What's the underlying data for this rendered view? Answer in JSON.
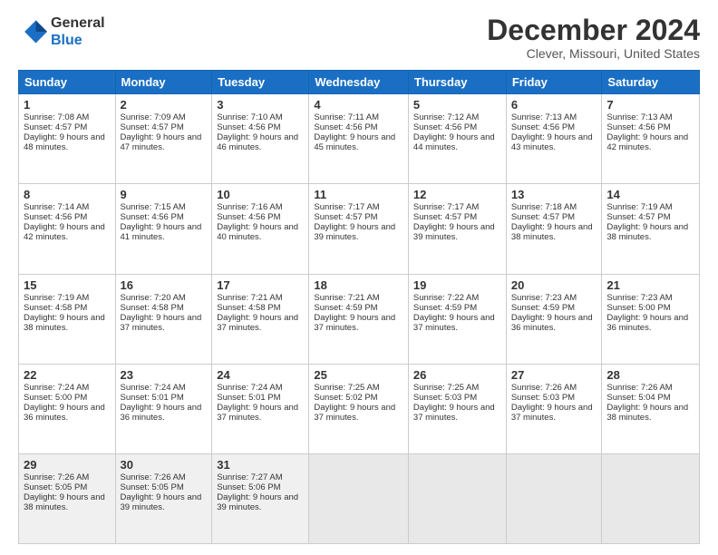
{
  "logo": {
    "line1": "General",
    "line2": "Blue"
  },
  "header": {
    "month": "December 2024",
    "location": "Clever, Missouri, United States"
  },
  "weekdays": [
    "Sunday",
    "Monday",
    "Tuesday",
    "Wednesday",
    "Thursday",
    "Friday",
    "Saturday"
  ],
  "weeks": [
    [
      {
        "day": "1",
        "sunrise": "Sunrise: 7:08 AM",
        "sunset": "Sunset: 4:57 PM",
        "daylight": "Daylight: 9 hours and 48 minutes."
      },
      {
        "day": "2",
        "sunrise": "Sunrise: 7:09 AM",
        "sunset": "Sunset: 4:57 PM",
        "daylight": "Daylight: 9 hours and 47 minutes."
      },
      {
        "day": "3",
        "sunrise": "Sunrise: 7:10 AM",
        "sunset": "Sunset: 4:56 PM",
        "daylight": "Daylight: 9 hours and 46 minutes."
      },
      {
        "day": "4",
        "sunrise": "Sunrise: 7:11 AM",
        "sunset": "Sunset: 4:56 PM",
        "daylight": "Daylight: 9 hours and 45 minutes."
      },
      {
        "day": "5",
        "sunrise": "Sunrise: 7:12 AM",
        "sunset": "Sunset: 4:56 PM",
        "daylight": "Daylight: 9 hours and 44 minutes."
      },
      {
        "day": "6",
        "sunrise": "Sunrise: 7:13 AM",
        "sunset": "Sunset: 4:56 PM",
        "daylight": "Daylight: 9 hours and 43 minutes."
      },
      {
        "day": "7",
        "sunrise": "Sunrise: 7:13 AM",
        "sunset": "Sunset: 4:56 PM",
        "daylight": "Daylight: 9 hours and 42 minutes."
      }
    ],
    [
      {
        "day": "8",
        "sunrise": "Sunrise: 7:14 AM",
        "sunset": "Sunset: 4:56 PM",
        "daylight": "Daylight: 9 hours and 42 minutes."
      },
      {
        "day": "9",
        "sunrise": "Sunrise: 7:15 AM",
        "sunset": "Sunset: 4:56 PM",
        "daylight": "Daylight: 9 hours and 41 minutes."
      },
      {
        "day": "10",
        "sunrise": "Sunrise: 7:16 AM",
        "sunset": "Sunset: 4:56 PM",
        "daylight": "Daylight: 9 hours and 40 minutes."
      },
      {
        "day": "11",
        "sunrise": "Sunrise: 7:17 AM",
        "sunset": "Sunset: 4:57 PM",
        "daylight": "Daylight: 9 hours and 39 minutes."
      },
      {
        "day": "12",
        "sunrise": "Sunrise: 7:17 AM",
        "sunset": "Sunset: 4:57 PM",
        "daylight": "Daylight: 9 hours and 39 minutes."
      },
      {
        "day": "13",
        "sunrise": "Sunrise: 7:18 AM",
        "sunset": "Sunset: 4:57 PM",
        "daylight": "Daylight: 9 hours and 38 minutes."
      },
      {
        "day": "14",
        "sunrise": "Sunrise: 7:19 AM",
        "sunset": "Sunset: 4:57 PM",
        "daylight": "Daylight: 9 hours and 38 minutes."
      }
    ],
    [
      {
        "day": "15",
        "sunrise": "Sunrise: 7:19 AM",
        "sunset": "Sunset: 4:58 PM",
        "daylight": "Daylight: 9 hours and 38 minutes."
      },
      {
        "day": "16",
        "sunrise": "Sunrise: 7:20 AM",
        "sunset": "Sunset: 4:58 PM",
        "daylight": "Daylight: 9 hours and 37 minutes."
      },
      {
        "day": "17",
        "sunrise": "Sunrise: 7:21 AM",
        "sunset": "Sunset: 4:58 PM",
        "daylight": "Daylight: 9 hours and 37 minutes."
      },
      {
        "day": "18",
        "sunrise": "Sunrise: 7:21 AM",
        "sunset": "Sunset: 4:59 PM",
        "daylight": "Daylight: 9 hours and 37 minutes."
      },
      {
        "day": "19",
        "sunrise": "Sunrise: 7:22 AM",
        "sunset": "Sunset: 4:59 PM",
        "daylight": "Daylight: 9 hours and 37 minutes."
      },
      {
        "day": "20",
        "sunrise": "Sunrise: 7:23 AM",
        "sunset": "Sunset: 4:59 PM",
        "daylight": "Daylight: 9 hours and 36 minutes."
      },
      {
        "day": "21",
        "sunrise": "Sunrise: 7:23 AM",
        "sunset": "Sunset: 5:00 PM",
        "daylight": "Daylight: 9 hours and 36 minutes."
      }
    ],
    [
      {
        "day": "22",
        "sunrise": "Sunrise: 7:24 AM",
        "sunset": "Sunset: 5:00 PM",
        "daylight": "Daylight: 9 hours and 36 minutes."
      },
      {
        "day": "23",
        "sunrise": "Sunrise: 7:24 AM",
        "sunset": "Sunset: 5:01 PM",
        "daylight": "Daylight: 9 hours and 36 minutes."
      },
      {
        "day": "24",
        "sunrise": "Sunrise: 7:24 AM",
        "sunset": "Sunset: 5:01 PM",
        "daylight": "Daylight: 9 hours and 37 minutes."
      },
      {
        "day": "25",
        "sunrise": "Sunrise: 7:25 AM",
        "sunset": "Sunset: 5:02 PM",
        "daylight": "Daylight: 9 hours and 37 minutes."
      },
      {
        "day": "26",
        "sunrise": "Sunrise: 7:25 AM",
        "sunset": "Sunset: 5:03 PM",
        "daylight": "Daylight: 9 hours and 37 minutes."
      },
      {
        "day": "27",
        "sunrise": "Sunrise: 7:26 AM",
        "sunset": "Sunset: 5:03 PM",
        "daylight": "Daylight: 9 hours and 37 minutes."
      },
      {
        "day": "28",
        "sunrise": "Sunrise: 7:26 AM",
        "sunset": "Sunset: 5:04 PM",
        "daylight": "Daylight: 9 hours and 38 minutes."
      }
    ],
    [
      {
        "day": "29",
        "sunrise": "Sunrise: 7:26 AM",
        "sunset": "Sunset: 5:05 PM",
        "daylight": "Daylight: 9 hours and 38 minutes."
      },
      {
        "day": "30",
        "sunrise": "Sunrise: 7:26 AM",
        "sunset": "Sunset: 5:05 PM",
        "daylight": "Daylight: 9 hours and 39 minutes."
      },
      {
        "day": "31",
        "sunrise": "Sunrise: 7:27 AM",
        "sunset": "Sunset: 5:06 PM",
        "daylight": "Daylight: 9 hours and 39 minutes."
      },
      null,
      null,
      null,
      null
    ]
  ]
}
